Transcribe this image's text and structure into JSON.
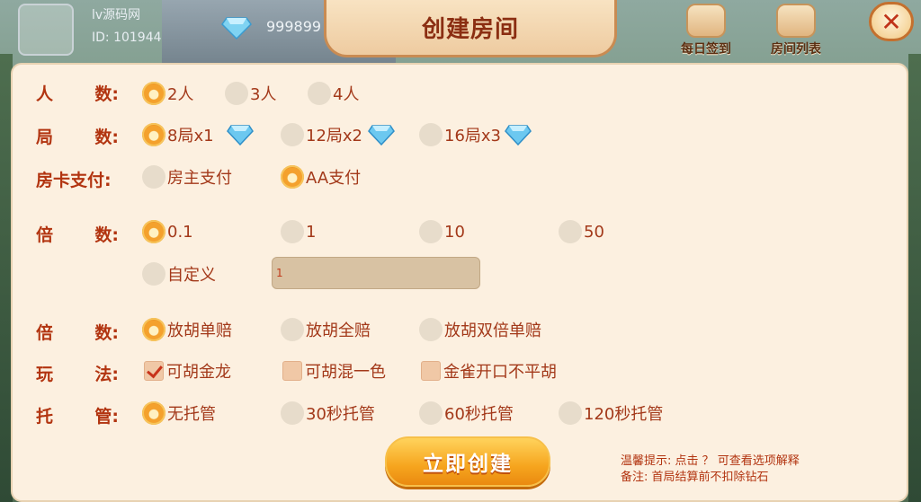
{
  "header": {
    "username": "lv源码网",
    "user_id": "ID: 101944",
    "diamonds": "999899",
    "title": "创建房间",
    "daily_checkin": "每日签到",
    "room_list": "房间列表",
    "close_symbol": "✕"
  },
  "rows": {
    "players": {
      "label": [
        "人",
        "数:"
      ],
      "options": [
        {
          "text": "2人",
          "selected": true
        },
        {
          "text": "3人",
          "selected": false
        },
        {
          "text": "4人",
          "selected": false
        }
      ]
    },
    "rounds": {
      "label": [
        "局",
        "数:"
      ],
      "options": [
        {
          "text": "8局x1",
          "selected": true
        },
        {
          "text": "12局x2",
          "selected": false
        },
        {
          "text": "16局x3",
          "selected": false
        }
      ]
    },
    "payment": {
      "label": "房卡支付:",
      "options": [
        {
          "text": "房主支付",
          "selected": false
        },
        {
          "text": "AA支付",
          "selected": true
        }
      ]
    },
    "multiplier": {
      "label": [
        "倍",
        "数:"
      ],
      "options": [
        {
          "text": "0.1",
          "selected": true
        },
        {
          "text": "1",
          "selected": false
        },
        {
          "text": "10",
          "selected": false
        },
        {
          "text": "50",
          "selected": false
        },
        {
          "text": "自定义",
          "selected": false
        }
      ],
      "custom_value": "1"
    },
    "payout": {
      "label": [
        "倍",
        "数:"
      ],
      "options": [
        {
          "text": "放胡单赔",
          "selected": true
        },
        {
          "text": "放胡全赔",
          "selected": false
        },
        {
          "text": "放胡双倍单赔",
          "selected": false
        }
      ]
    },
    "rules": {
      "label": [
        "玩",
        "法:"
      ],
      "options": [
        {
          "text": "可胡金龙",
          "checked": true
        },
        {
          "text": "可胡混一色",
          "checked": false
        },
        {
          "text": "金雀开口不平胡",
          "checked": false
        }
      ]
    },
    "auto": {
      "label": [
        "托",
        "管:"
      ],
      "options": [
        {
          "text": "无托管",
          "selected": true
        },
        {
          "text": "30秒托管",
          "selected": false
        },
        {
          "text": "60秒托管",
          "selected": false
        },
        {
          "text": "120秒托管",
          "selected": false
        }
      ]
    }
  },
  "create_button": "立即创建",
  "tips": {
    "line1": "温馨提示: 点击 ？  可查看选项解释",
    "line2": "备注: 首局结算前不扣除钻石"
  },
  "colors": {
    "accent": "#b23410",
    "panel": "#fcf0e0",
    "button": "#f6a51e"
  }
}
